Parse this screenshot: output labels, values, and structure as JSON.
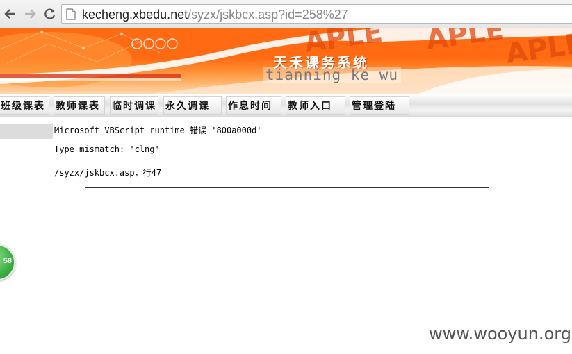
{
  "browser": {
    "url_host": "kecheng.xbedu.net",
    "url_path": "/syzx/jskbcx.asp?id=258%27"
  },
  "banner": {
    "title": "天禾课务系统",
    "subtitle": "tianning ke wu",
    "watermark_letters": "APLE"
  },
  "menu": {
    "items": [
      {
        "label": "班级课表"
      },
      {
        "label": "教师课表"
      },
      {
        "label": "临时调课"
      },
      {
        "label": "永久调课"
      },
      {
        "label": "作息时间"
      },
      {
        "label": "教师入口"
      },
      {
        "label": "管理登陆"
      }
    ]
  },
  "error": {
    "line1": "Microsoft VBScript runtime 错误 '800a000d'",
    "line2": "Type mismatch: 'clng'",
    "line3": "/syzx/jskbcx.asp，行47"
  },
  "float_badge": {
    "text": "58"
  },
  "footer": {
    "watermark": "www.wooyun.org"
  },
  "colors": {
    "banner_orange": "#ff6a10",
    "badge_green": "#3cb043"
  }
}
